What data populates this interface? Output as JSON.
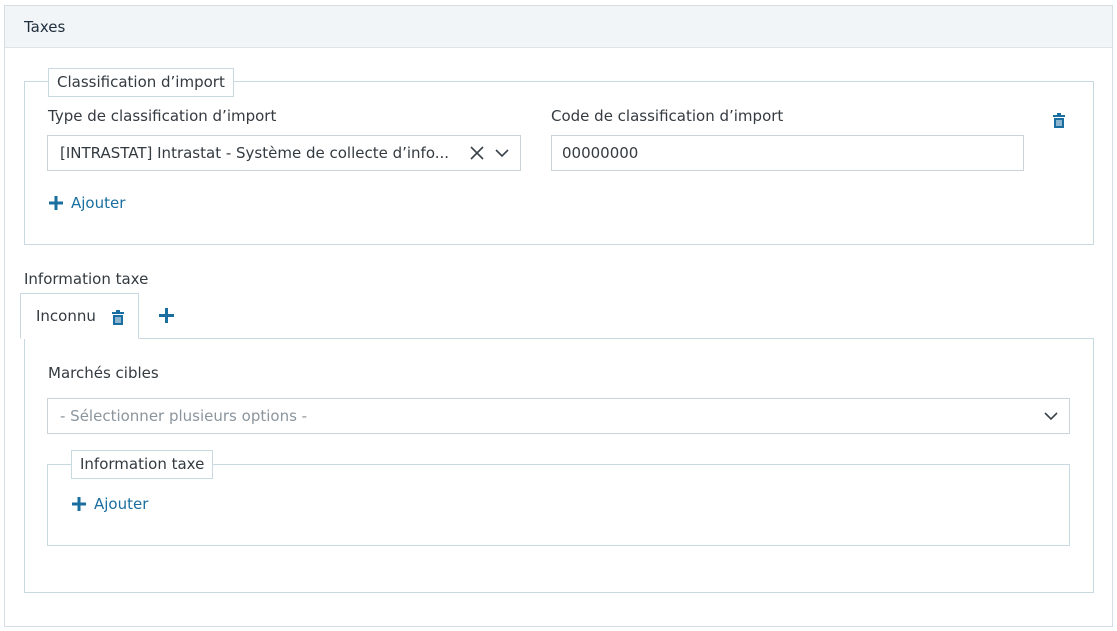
{
  "panel": {
    "title": "Taxes"
  },
  "import_classification": {
    "legend": "Classification d’import",
    "type_label": "Type de classification d’import",
    "type_value": "[INTRASTAT] Intrastat - Système de collecte d’info...",
    "code_label": "Code de classification d’import",
    "code_value": "00000000",
    "add_label": "Ajouter"
  },
  "tax_info": {
    "section_label": "Information taxe",
    "tabs": [
      {
        "label": "Inconnu"
      }
    ],
    "markets_label": "Marchés cibles",
    "markets_placeholder": "- Sélectionner plusieurs options -",
    "inner_legend": "Information taxe",
    "add_label": "Ajouter"
  },
  "colors": {
    "accent": "#1a6ea0",
    "border": "#c9d9e2",
    "header_bg": "#f2f5f8"
  },
  "icons": [
    "trash-icon",
    "plus-icon",
    "clear-x-icon",
    "chevron-down-icon"
  ]
}
